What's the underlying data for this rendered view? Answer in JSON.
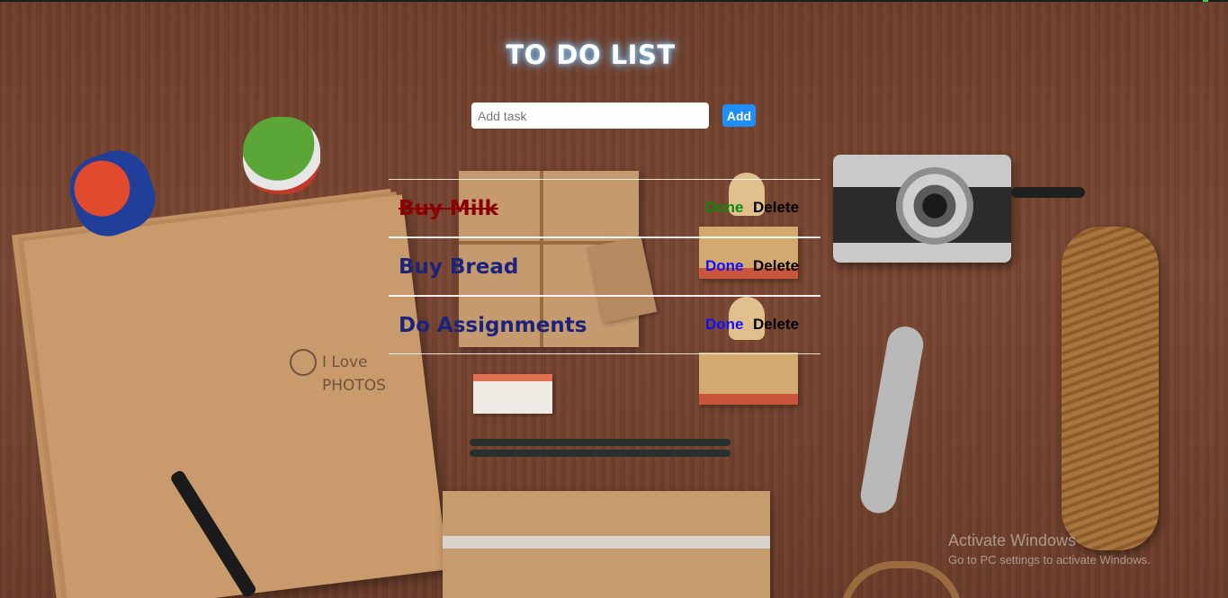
{
  "app": {
    "title": "TO DO LIST"
  },
  "form": {
    "input_placeholder": "Add task",
    "input_value": "",
    "add_label": "Add"
  },
  "tasks": [
    {
      "label": "Buy Milk",
      "completed": true,
      "done_label": "Done",
      "delete_label": "Delete"
    },
    {
      "label": "Buy Bread",
      "completed": false,
      "done_label": "Done",
      "delete_label": "Delete"
    },
    {
      "label": "Do Assignments",
      "completed": false,
      "done_label": "Done",
      "delete_label": "Delete"
    }
  ],
  "background": {
    "paper_logo_line1": "I Love",
    "paper_logo_line2": "PHOTOS"
  },
  "watermark": {
    "title": "Activate Windows",
    "subtitle": "Go to PC settings to activate Windows."
  },
  "colors": {
    "accent_button": "#1f8ff5",
    "completed_text": "#8b0000",
    "pending_text": "#1c237a",
    "done_completed": "#0b8a0b",
    "done_pending": "#1010ff"
  }
}
